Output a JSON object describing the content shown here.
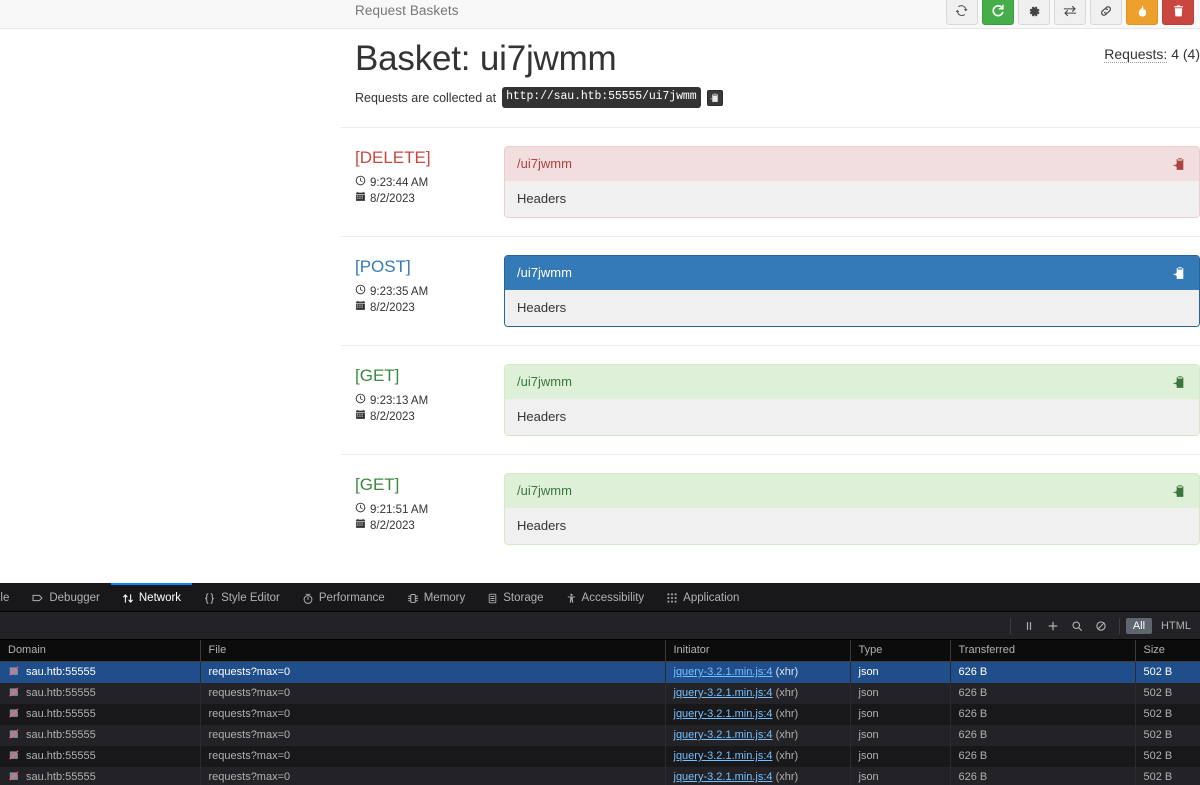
{
  "navbar": {
    "brand": "Request Baskets",
    "buttons": [
      {
        "name": "refresh-auto-button",
        "icon": "sync-icon",
        "style": "default"
      },
      {
        "name": "refresh-button",
        "icon": "refresh-icon",
        "style": "success"
      },
      {
        "name": "settings-button",
        "icon": "gear-icon",
        "style": "default"
      },
      {
        "name": "forward-button",
        "icon": "exchange-icon",
        "style": "default"
      },
      {
        "name": "link-button",
        "icon": "link-icon",
        "style": "default"
      },
      {
        "name": "flush-button",
        "icon": "fire-icon",
        "style": "warning"
      },
      {
        "name": "delete-basket-button",
        "icon": "trash-icon",
        "style": "danger"
      }
    ]
  },
  "page": {
    "title": "Basket: ui7jwmm",
    "requests_label": "Requests:",
    "requests_value": "4 (4)",
    "collected_prefix": "Requests are collected at",
    "collected_url": "http://sau.htb:55555/ui7jwmm"
  },
  "requests": [
    {
      "method": "[DELETE]",
      "method_class": "m-delete",
      "panel_class": "p-danger",
      "time": "9:23:44 AM",
      "date": "8/2/2023",
      "path": "/ui7jwmm",
      "body_label": "Headers"
    },
    {
      "method": "[POST]",
      "method_class": "m-post",
      "panel_class": "p-primary",
      "time": "9:23:35 AM",
      "date": "8/2/2023",
      "path": "/ui7jwmm",
      "body_label": "Headers"
    },
    {
      "method": "[GET]",
      "method_class": "m-get",
      "panel_class": "p-success",
      "time": "9:23:13 AM",
      "date": "8/2/2023",
      "path": "/ui7jwmm",
      "body_label": "Headers"
    },
    {
      "method": "[GET]",
      "method_class": "m-get",
      "panel_class": "p-success",
      "time": "9:21:51 AM",
      "date": "8/2/2023",
      "path": "/ui7jwmm",
      "body_label": "Headers"
    }
  ],
  "devtools": {
    "tabs": [
      {
        "label": "ole",
        "icon": "console-icon",
        "active": false,
        "clipped": true
      },
      {
        "label": "Debugger",
        "icon": "debugger-icon",
        "active": false
      },
      {
        "label": "Network",
        "icon": "network-icon",
        "active": true
      },
      {
        "label": "Style Editor",
        "icon": "braces-icon",
        "active": false
      },
      {
        "label": "Performance",
        "icon": "stopwatch-icon",
        "active": false
      },
      {
        "label": "Memory",
        "icon": "memory-icon",
        "active": false
      },
      {
        "label": "Storage",
        "icon": "storage-icon",
        "active": false
      },
      {
        "label": "Accessibility",
        "icon": "accessibility-icon",
        "active": false
      },
      {
        "label": "Application",
        "icon": "application-icon",
        "active": false
      }
    ],
    "toolbar_icons": [
      {
        "name": "pause-icon"
      },
      {
        "name": "plus-icon"
      },
      {
        "name": "search-icon"
      },
      {
        "name": "clear-icon"
      }
    ],
    "filters": [
      {
        "label": "All",
        "active": true
      },
      {
        "label": "HTML",
        "active": false
      }
    ],
    "columns": [
      "Domain",
      "File",
      "Initiator",
      "Type",
      "Transferred",
      "Size"
    ],
    "rows": [
      {
        "domain": "sau.htb:55555",
        "file": "requests?max=0",
        "initiator": "jquery-3.2.1.min.js:4",
        "initiator_suffix": "(xhr)",
        "type": "json",
        "transferred": "626 B",
        "size": "502 B",
        "selected": true
      },
      {
        "domain": "sau.htb:55555",
        "file": "requests?max=0",
        "initiator": "jquery-3.2.1.min.js:4",
        "initiator_suffix": "(xhr)",
        "type": "json",
        "transferred": "626 B",
        "size": "502 B",
        "selected": false
      },
      {
        "domain": "sau.htb:55555",
        "file": "requests?max=0",
        "initiator": "jquery-3.2.1.min.js:4",
        "initiator_suffix": "(xhr)",
        "type": "json",
        "transferred": "626 B",
        "size": "502 B",
        "selected": false
      },
      {
        "domain": "sau.htb:55555",
        "file": "requests?max=0",
        "initiator": "jquery-3.2.1.min.js:4",
        "initiator_suffix": "(xhr)",
        "type": "json",
        "transferred": "626 B",
        "size": "502 B",
        "selected": false
      },
      {
        "domain": "sau.htb:55555",
        "file": "requests?max=0",
        "initiator": "jquery-3.2.1.min.js:4",
        "initiator_suffix": "(xhr)",
        "type": "json",
        "transferred": "626 B",
        "size": "502 B",
        "selected": false
      },
      {
        "domain": "sau.htb:55555",
        "file": "requests?max=0",
        "initiator": "jquery-3.2.1.min.js:4",
        "initiator_suffix": "(xhr)",
        "type": "json",
        "transferred": "626 B",
        "size": "502 B",
        "selected": false
      }
    ]
  },
  "colors": {
    "brand_primary": "#337ab7",
    "success": "#45ad4a",
    "warning": "#eda12c",
    "danger": "#c9473f",
    "devtools_accent": "#0a84ff",
    "devtools_selection": "#204e8a"
  }
}
